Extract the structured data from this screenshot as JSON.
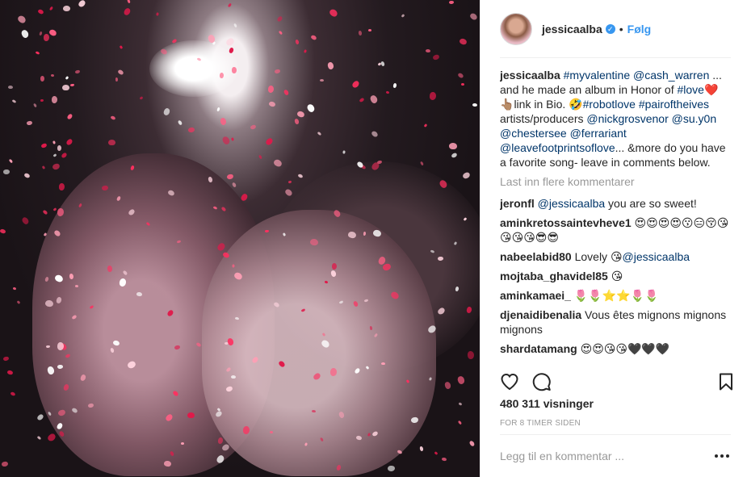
{
  "post": {
    "username": "jessicaalba",
    "dot": "•",
    "follow_label": "Følg",
    "caption": {
      "author": "jessicaalba",
      "line1_tag1": "#myvalentine",
      "line1_tag2": "@cash_warren",
      "line1_tail": " ... and he made an album in Honor of ",
      "line1_tag3": "#love",
      "line1_emoji": "❤️",
      "line2_emoji": "👆🏽",
      "line2_text": "link in Bio. ",
      "line2_emoji2": "🤣",
      "line2_tag1": "#robotlove",
      "line2_tag2": "#pairoftheives",
      "line3_text": " artists/producers ",
      "line3_tag1": "@nickgrosvenor",
      "line3_tag2": "@su.y0n",
      "line3_tag3": "@chestersee",
      "line3_tag4": "@ferrariant",
      "line3_tag5": "@leavefootprintsoflove",
      "line3_tail": "... &more do you have a favorite song- leave in comments below."
    },
    "load_more": "Last inn flere kommentarer",
    "comments": [
      {
        "user": "jeronfl",
        "mention": "@jessicaalba",
        "text": " you are so sweet!"
      },
      {
        "user": "aminkretossaintevheve1",
        "mention": "",
        "text": " 😍😍😍😍😗😑😚😘😘😘😘😎😎"
      },
      {
        "user": "nabeelabid80",
        "mention": "",
        "text": " Lovely 😘",
        "mention_after": "@jessicaalba"
      },
      {
        "user": "mojtaba_ghavidel85",
        "mention": "",
        "text": " 😘"
      },
      {
        "user": "aminkamaei_",
        "mention": "",
        "text": " 🌷🌷⭐⭐🌷🌷"
      },
      {
        "user": "djenaidibenalia",
        "mention": "",
        "text": " Vous êtes mignons mignons mignons"
      },
      {
        "user": "shardatamang",
        "mention": "",
        "text": " 😍😍😘😘🖤🖤🖤"
      }
    ],
    "views": "480 311 visninger",
    "time": "FOR 8 TIMER SIDEN",
    "add_comment_placeholder": "Legg til en kommentar ...",
    "icons": {
      "like": "heart-icon",
      "comment": "comment-icon",
      "save": "bookmark-icon",
      "more": "more-options-icon",
      "verified": "verified-badge-icon"
    },
    "colors": {
      "link": "#003569",
      "follow": "#3897f0",
      "muted": "#999999",
      "text": "#262626"
    }
  }
}
